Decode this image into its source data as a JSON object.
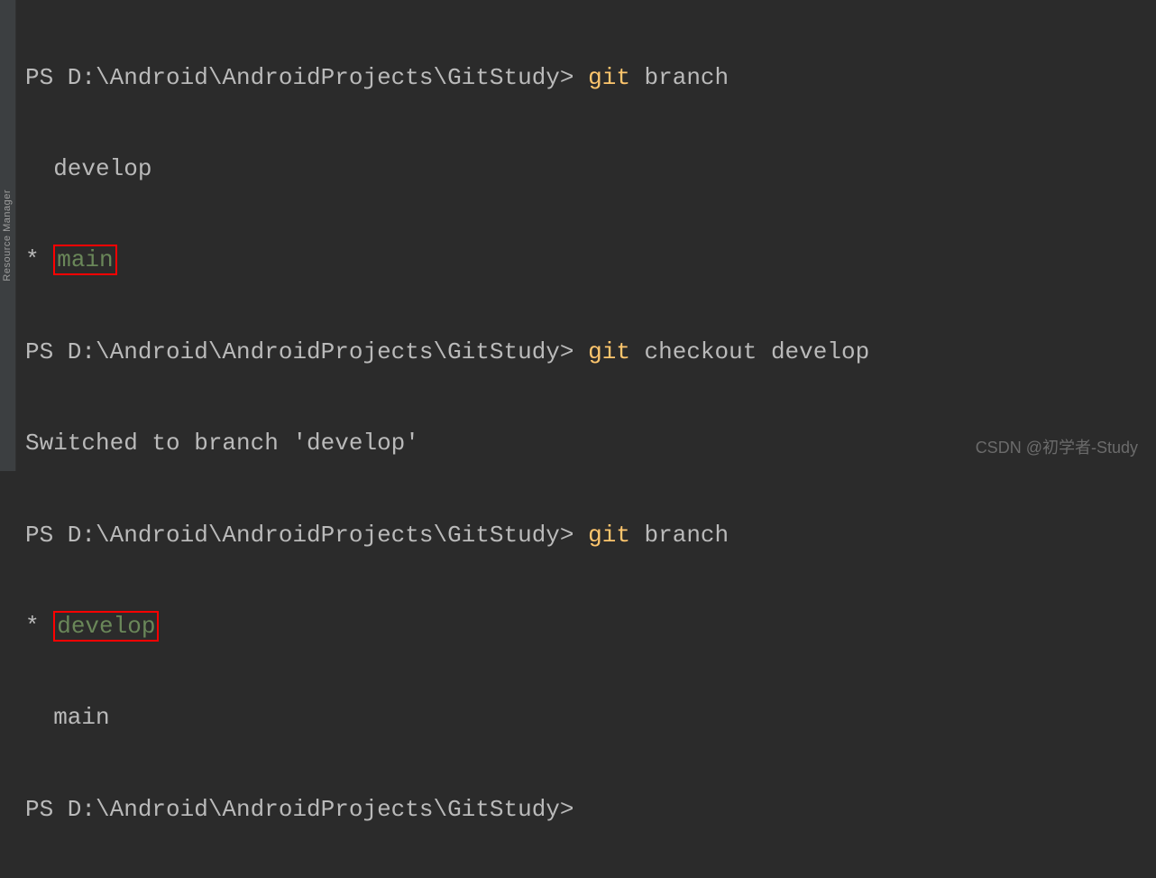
{
  "sidebar": {
    "label": "Resource Manager"
  },
  "terminal": {
    "prompt": "PS D:\\Android\\AndroidProjects\\GitStudy>",
    "lines": [
      {
        "type": "command",
        "git": "git",
        "args": " branch"
      },
      {
        "type": "output",
        "text": "  develop"
      },
      {
        "type": "branch-current",
        "prefix": "* ",
        "branch": "main"
      },
      {
        "type": "command",
        "git": "git",
        "args": " checkout develop"
      },
      {
        "type": "output",
        "text": "Switched to branch 'develop'"
      },
      {
        "type": "command",
        "git": "git",
        "args": " branch"
      },
      {
        "type": "branch-current",
        "prefix": "* ",
        "branch": "develop"
      },
      {
        "type": "output",
        "text": "  main"
      },
      {
        "type": "prompt-only"
      }
    ]
  },
  "watermark": "CSDN @初学者-Study"
}
